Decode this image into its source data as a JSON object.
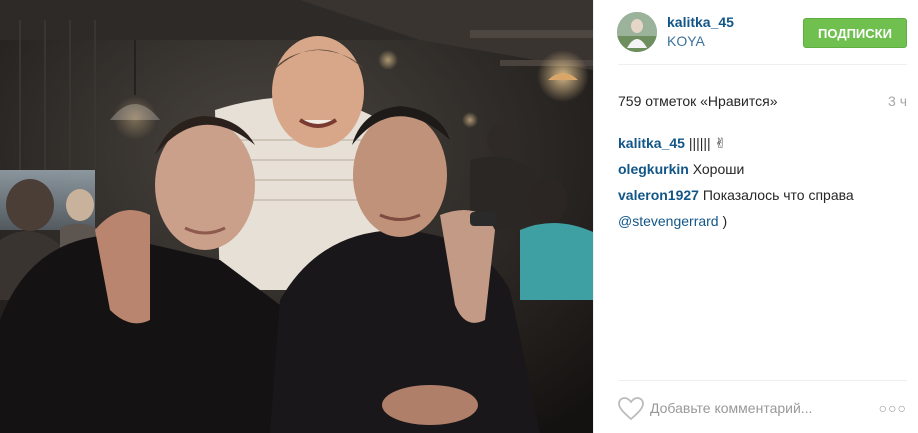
{
  "post": {
    "username": "kalitka_45",
    "location": "KOYA",
    "follow_label": "ПОДПИСКИ",
    "likes_text": "759 отметок «Нравится»",
    "time": "3 ч",
    "caption": {
      "author": "kalitka_45",
      "text": "|||||| ✌"
    },
    "comments": [
      {
        "author": "olegkurkin",
        "text": "Хороши"
      },
      {
        "author": "valeron1927",
        "text": "Показалось что справа",
        "mention": "@stevengerrard",
        "tail": " )"
      }
    ],
    "add_comment_placeholder": "Добавьте комментарий...",
    "more_label": "○○○"
  },
  "colors": {
    "link": "#125688",
    "follow_green": "#70c050",
    "muted": "#a5a7aa"
  },
  "icons": {
    "like": "heart-outline-icon",
    "more": "more-options-icon"
  }
}
